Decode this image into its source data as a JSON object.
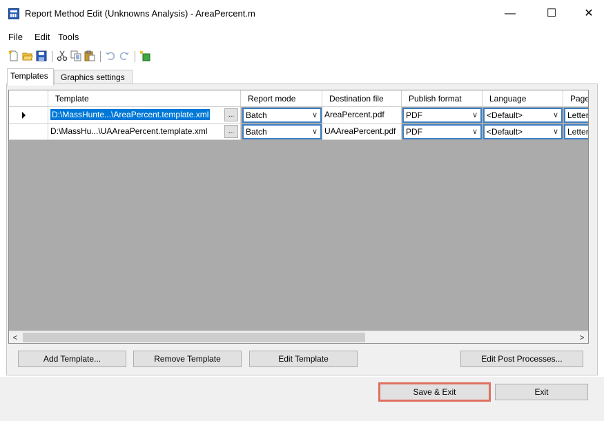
{
  "window": {
    "title": "Report Method Edit (Unknowns Analysis) - AreaPercent.m",
    "minimize": "—",
    "maximize": "☐",
    "close": "✕"
  },
  "menu": [
    "File",
    "Edit",
    "Tools"
  ],
  "toolbar_icons": [
    "new-icon",
    "open-icon",
    "save-icon",
    "cut-icon",
    "copy-icon",
    "paste-icon",
    "undo-icon",
    "redo-icon",
    "add-icon"
  ],
  "tabs": [
    {
      "label": "Templates",
      "active": true
    },
    {
      "label": "Graphics settings",
      "active": false
    }
  ],
  "grid": {
    "columns": [
      "Template",
      "Report mode",
      "Destination file",
      "Publish format",
      "Language",
      "Page"
    ],
    "rows": [
      {
        "template": "D:\\MassHunte...\\AreaPercent.template.xml",
        "ellipsis": "...",
        "report_mode": "Batch",
        "destination_file": "AreaPercent.pdf",
        "publish_format": "PDF",
        "language": "<Default>",
        "page": "Letter",
        "selected": true
      },
      {
        "template": "D:\\MassHu...\\UAAreaPercent.template.xml",
        "ellipsis": "...",
        "report_mode": "Batch",
        "destination_file": "UAAreaPercent.pdf",
        "publish_format": "PDF",
        "language": "<Default>",
        "page": "Letter",
        "selected": false
      }
    ],
    "scroll_left": "<",
    "scroll_right": ">"
  },
  "buttons": {
    "add_template": "Add Template...",
    "remove_template": "Remove Template",
    "edit_template": "Edit Template",
    "edit_post_processes": "Edit Post Processes...",
    "save_exit": "Save & Exit",
    "exit": "Exit"
  },
  "colors": {
    "selection": "#0078d7",
    "grid_background": "#ababab",
    "combo_border": "#3c7fc4",
    "highlight_border": "#e07060"
  }
}
